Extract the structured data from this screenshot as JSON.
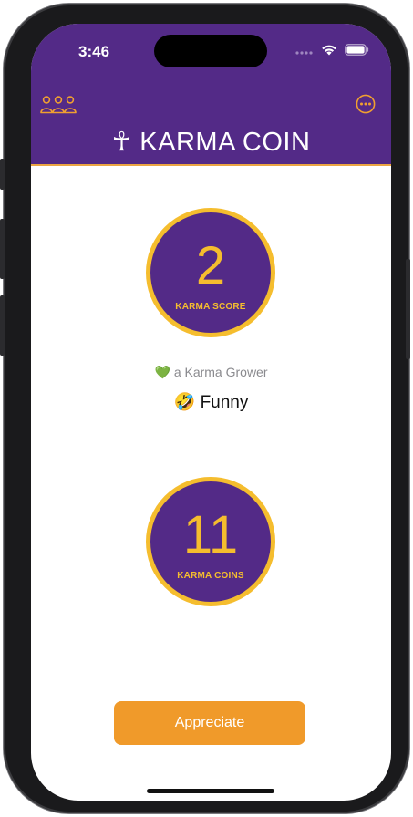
{
  "status_bar": {
    "time": "3:46"
  },
  "nav": {
    "left_icon": "people-group-icon",
    "right_icon": "more-options-icon"
  },
  "app": {
    "symbol": "☥",
    "title": "KARMA COIN"
  },
  "karma_score": {
    "value": "2",
    "label": "KARMA SCORE"
  },
  "rank": {
    "emoji": "💚",
    "text": "a Karma Grower"
  },
  "trait": {
    "emoji": "🤣",
    "text": "Funny"
  },
  "karma_coins": {
    "value": "11",
    "label": "KARMA COINS"
  },
  "actions": {
    "appreciate_label": "Appreciate"
  },
  "colors": {
    "header_purple": "#532a87",
    "accent_gold": "#f5bd2e",
    "button_orange": "#f09a2a"
  }
}
